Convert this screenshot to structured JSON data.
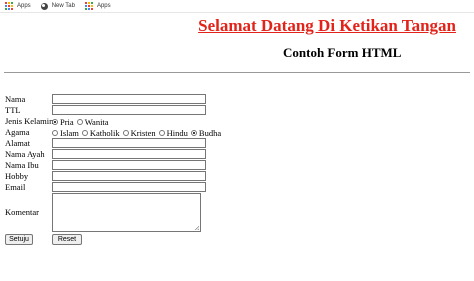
{
  "bookmarks": [
    {
      "label": "Apps",
      "icon": "apps-icon"
    },
    {
      "label": "New Tab",
      "icon": "globe-icon"
    },
    {
      "label": "Apps",
      "icon": "apps-icon"
    }
  ],
  "header": {
    "title": "Selamat Datang Di Ketikan Tangan",
    "subtitle": "Contoh Form HTML"
  },
  "form": {
    "nama_label": "Nama",
    "ttl_label": "TTL",
    "jenis_kelamin_label": "Jenis Kelamin",
    "jenis_kelamin_options": [
      "Pria",
      "Wanita"
    ],
    "jenis_kelamin_selected": "Pria",
    "agama_label": "Agama",
    "agama_options": [
      "Islam",
      "Katholik",
      "Kristen",
      "Hindu",
      "Budha"
    ],
    "agama_selected": "Budha",
    "alamat_label": "Alamat",
    "nama_ayah_label": "Nama Ayah",
    "nama_ibu_label": "Nama Ibu",
    "hobby_label": "Hobby",
    "email_label": "Email",
    "komentar_label": "Komentar",
    "submit_label": "Setuju",
    "reset_label": "Reset"
  },
  "colors": {
    "title": "#e2231a",
    "apps_icon": [
      "#ea4335",
      "#fbbc05",
      "#34a853",
      "#4285f4",
      "#ea4335",
      "#fbbc05",
      "#34a853",
      "#4285f4",
      "#ea4335"
    ]
  }
}
